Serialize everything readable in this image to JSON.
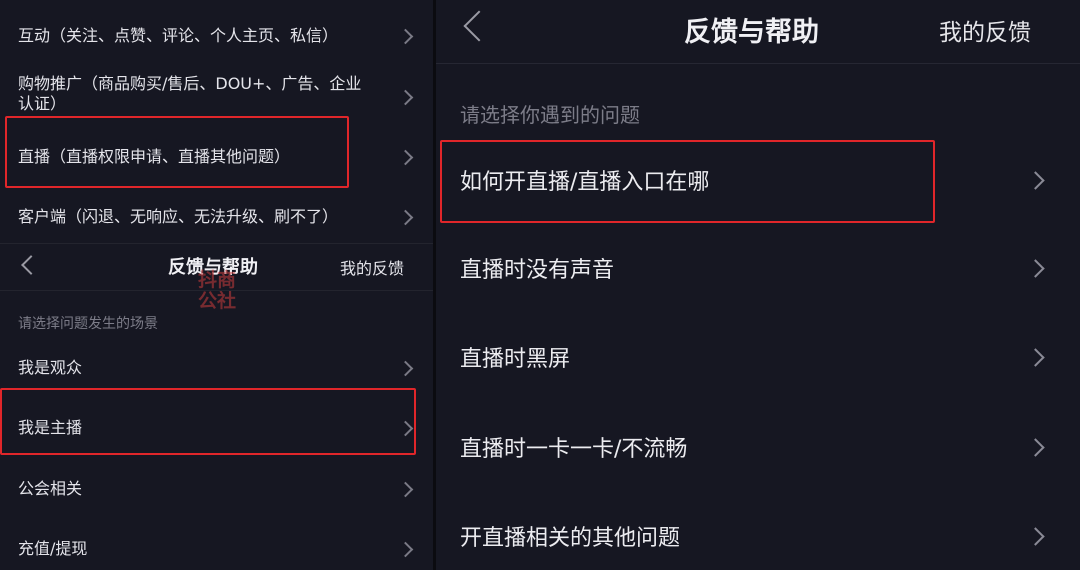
{
  "left": {
    "top_list": [
      {
        "label": "互动（关注、点赞、评论、个人主页、私信）"
      },
      {
        "label_line1": "购物推广（商品购买/售后、DOU+、广告、企业",
        "label_line2": "认证）"
      },
      {
        "label": "直播（直播权限申请、直播其他问题）"
      },
      {
        "label": "客户端（闪退、无响应、无法升级、刷不了）"
      }
    ],
    "header": {
      "title": "反馈与帮助",
      "my_feedback": "我的反馈"
    },
    "watermark": {
      "line1": "抖商",
      "line2": "公社"
    },
    "section_label": "请选择问题发生的场景",
    "scene_list": [
      {
        "label": "我是观众"
      },
      {
        "label": "我是主播"
      },
      {
        "label": "公会相关"
      },
      {
        "label": "充值/提现"
      }
    ]
  },
  "right": {
    "header": {
      "title": "反馈与帮助",
      "my_feedback": "我的反馈"
    },
    "section_label": "请选择你遇到的问题",
    "items": [
      {
        "label": "如何开直播/直播入口在哪"
      },
      {
        "label": "直播时没有声音"
      },
      {
        "label": "直播时黑屏"
      },
      {
        "label": "直播时一卡一卡/不流畅"
      },
      {
        "label": "开直播相关的其他问题"
      }
    ]
  },
  "colors": {
    "background": "#161722",
    "highlight_border": "#e0262a",
    "text": "#e4e4ea",
    "muted_text": "#8a8a96"
  }
}
